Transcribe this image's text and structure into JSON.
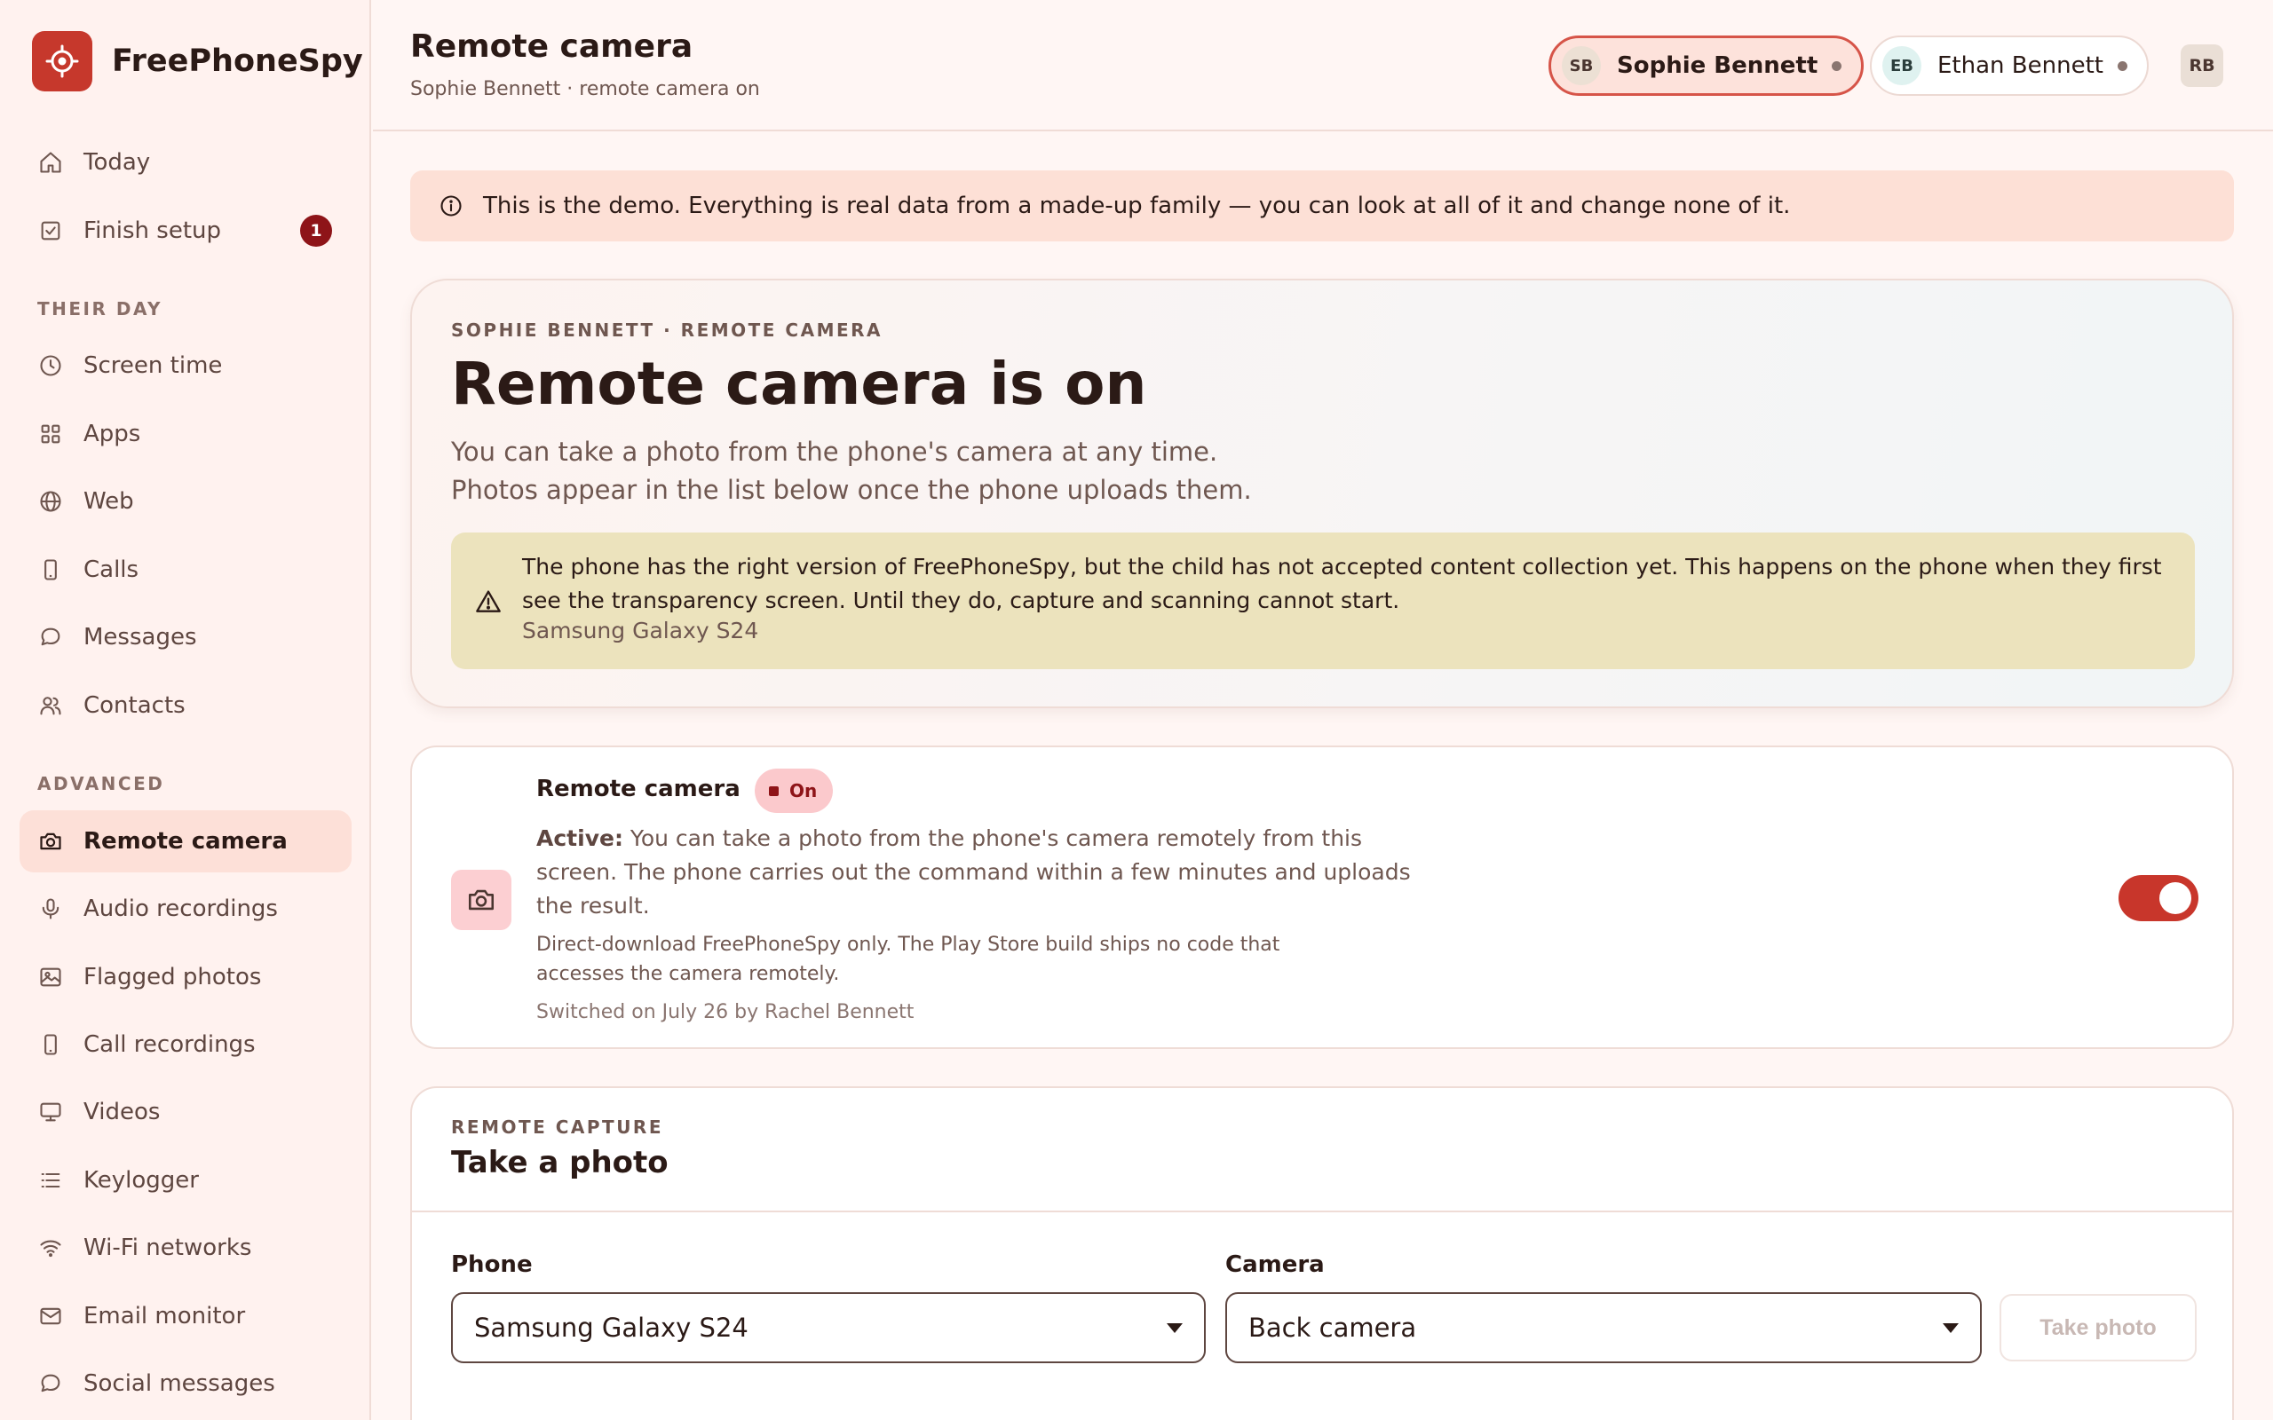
{
  "brand": {
    "name": "FreePhoneSpy",
    "accent": "#c6382c"
  },
  "sidebar": {
    "top_items": [
      {
        "label": "Today",
        "icon": "home-icon"
      },
      {
        "label": "Finish setup",
        "icon": "checkbox-icon",
        "badge": "1"
      }
    ],
    "sections": [
      {
        "title": "THEIR DAY",
        "items": [
          {
            "label": "Screen time",
            "icon": "clock-icon"
          },
          {
            "label": "Apps",
            "icon": "grid-icon"
          },
          {
            "label": "Web",
            "icon": "globe-icon"
          },
          {
            "label": "Calls",
            "icon": "phone-icon"
          },
          {
            "label": "Messages",
            "icon": "chat-icon"
          },
          {
            "label": "Contacts",
            "icon": "people-icon"
          }
        ]
      },
      {
        "title": "ADVANCED",
        "items": [
          {
            "label": "Remote camera",
            "icon": "camera-icon",
            "active": true
          },
          {
            "label": "Audio recordings",
            "icon": "microphone-icon"
          },
          {
            "label": "Flagged photos",
            "icon": "image-icon"
          },
          {
            "label": "Call recordings",
            "icon": "phone-icon"
          },
          {
            "label": "Videos",
            "icon": "monitor-icon"
          },
          {
            "label": "Keylogger",
            "icon": "list-icon"
          },
          {
            "label": "Wi-Fi networks",
            "icon": "wifi-icon"
          },
          {
            "label": "Email monitor",
            "icon": "mail-icon"
          },
          {
            "label": "Social messages",
            "icon": "chat-icon"
          }
        ]
      }
    ]
  },
  "header": {
    "title": "Remote camera",
    "subtitle": "Sophie Bennett · remote camera on",
    "children": [
      {
        "initials": "SB",
        "name": "Sophie Bennett",
        "selected": true
      },
      {
        "initials": "EB",
        "name": "Ethan Bennett",
        "selected": false
      }
    ],
    "user_initials": "RB"
  },
  "demo_banner": {
    "icon": "info-icon",
    "text": "This is the demo. Everything is real data from a made-up family — you can look at all of it and change none of it."
  },
  "hero": {
    "eyebrow": "SOPHIE BENNETT · REMOTE CAMERA",
    "title": "Remote camera is on",
    "desc_line1": "You can take a photo from the phone's camera at any time.",
    "desc_line2": "Photos appear in the list below once the phone uploads them.",
    "warning": {
      "icon": "warning-icon",
      "text": "The phone has the right version of FreePhoneSpy, but the child has not accepted content collection yet. This happens on the phone when they first see the transparency screen. Until they do, capture and scanning cannot start.",
      "device": "Samsung Galaxy S24"
    }
  },
  "feature": {
    "icon": "camera-icon",
    "title": "Remote camera",
    "status": "On",
    "desc_strong": "Active:",
    "desc": " You can take a photo from the phone's camera remotely from this screen. The phone carries out the command within a few minutes and uploads the result.",
    "note": "Direct-download FreePhoneSpy only. The Play Store build ships no code that accesses the camera remotely.",
    "meta": "Switched on July 26 by Rachel Bennett",
    "enabled": true
  },
  "capture": {
    "eyebrow": "REMOTE CAPTURE",
    "title": "Take a photo",
    "phone_label": "Phone",
    "phone_value": "Samsung Galaxy S24",
    "camera_label": "Camera",
    "camera_value": "Back camera",
    "button": "Take photo"
  }
}
